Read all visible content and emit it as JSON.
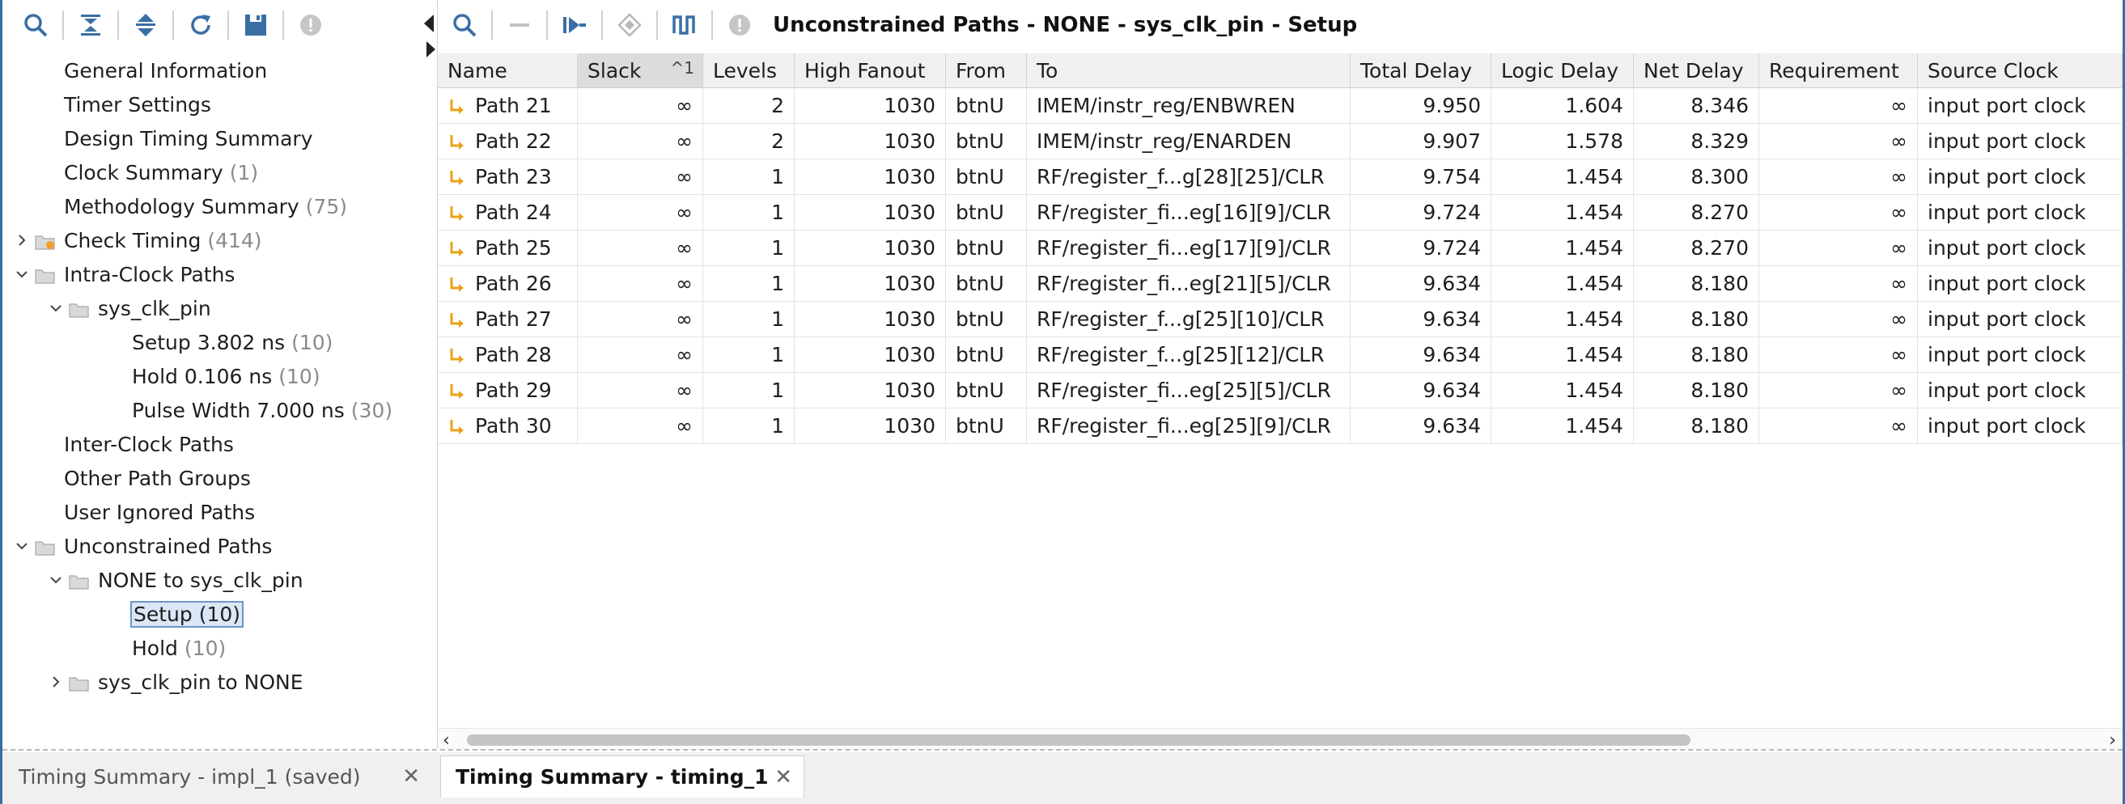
{
  "left_toolbar": {
    "icons": [
      "search-icon",
      "collapse-all-icon",
      "expand-all-icon",
      "refresh-icon",
      "save-icon",
      "disabled-icon"
    ]
  },
  "tree": {
    "items": [
      {
        "label": "General Information",
        "count": ""
      },
      {
        "label": "Timer Settings",
        "count": ""
      },
      {
        "label": "Design Timing Summary",
        "count": ""
      },
      {
        "label": "Clock Summary",
        "count": "(1)"
      },
      {
        "label": "Methodology Summary",
        "count": "(75)"
      },
      {
        "label": "Check Timing",
        "count": "(414)"
      },
      {
        "label": "Intra-Clock Paths",
        "count": ""
      },
      {
        "label": "sys_clk_pin",
        "count": ""
      },
      {
        "label": "Setup 3.802 ns",
        "count": "(10)"
      },
      {
        "label": "Hold 0.106 ns",
        "count": "(10)"
      },
      {
        "label": "Pulse Width 7.000 ns",
        "count": "(30)"
      },
      {
        "label": "Inter-Clock Paths",
        "count": ""
      },
      {
        "label": "Other Path Groups",
        "count": ""
      },
      {
        "label": "User Ignored Paths",
        "count": ""
      },
      {
        "label": "Unconstrained Paths",
        "count": ""
      },
      {
        "label": "NONE to sys_clk_pin",
        "count": ""
      },
      {
        "label": "Setup (10)",
        "count": ""
      },
      {
        "label": "Hold",
        "count": "(10)"
      },
      {
        "label": "sys_clk_pin to NONE",
        "count": ""
      }
    ]
  },
  "right_toolbar": {
    "title": "Unconstrained Paths - NONE - sys_clk_pin - Setup"
  },
  "table": {
    "columns": [
      "Name",
      "Slack",
      "Levels",
      "High Fanout",
      "From",
      "To",
      "Total Delay",
      "Logic Delay",
      "Net Delay",
      "Requirement",
      "Source Clock"
    ],
    "sort_indicator": "^1",
    "rows": [
      [
        "Path 21",
        "∞",
        "2",
        "1030",
        "btnU",
        "IMEM/instr_reg/ENBWREN",
        "9.950",
        "1.604",
        "8.346",
        "∞",
        "input port clock"
      ],
      [
        "Path 22",
        "∞",
        "2",
        "1030",
        "btnU",
        "IMEM/instr_reg/ENARDEN",
        "9.907",
        "1.578",
        "8.329",
        "∞",
        "input port clock"
      ],
      [
        "Path 23",
        "∞",
        "1",
        "1030",
        "btnU",
        "RF/register_f...g[28][25]/CLR",
        "9.754",
        "1.454",
        "8.300",
        "∞",
        "input port clock"
      ],
      [
        "Path 24",
        "∞",
        "1",
        "1030",
        "btnU",
        "RF/register_fi...eg[16][9]/CLR",
        "9.724",
        "1.454",
        "8.270",
        "∞",
        "input port clock"
      ],
      [
        "Path 25",
        "∞",
        "1",
        "1030",
        "btnU",
        "RF/register_fi...eg[17][9]/CLR",
        "9.724",
        "1.454",
        "8.270",
        "∞",
        "input port clock"
      ],
      [
        "Path 26",
        "∞",
        "1",
        "1030",
        "btnU",
        "RF/register_fi...eg[21][5]/CLR",
        "9.634",
        "1.454",
        "8.180",
        "∞",
        "input port clock"
      ],
      [
        "Path 27",
        "∞",
        "1",
        "1030",
        "btnU",
        "RF/register_f...g[25][10]/CLR",
        "9.634",
        "1.454",
        "8.180",
        "∞",
        "input port clock"
      ],
      [
        "Path 28",
        "∞",
        "1",
        "1030",
        "btnU",
        "RF/register_f...g[25][12]/CLR",
        "9.634",
        "1.454",
        "8.180",
        "∞",
        "input port clock"
      ],
      [
        "Path 29",
        "∞",
        "1",
        "1030",
        "btnU",
        "RF/register_fi...eg[25][5]/CLR",
        "9.634",
        "1.454",
        "8.180",
        "∞",
        "input port clock"
      ],
      [
        "Path 30",
        "∞",
        "1",
        "1030",
        "btnU",
        "RF/register_fi...eg[25][9]/CLR",
        "9.634",
        "1.454",
        "8.180",
        "∞",
        "input port clock"
      ]
    ]
  },
  "tabs": [
    {
      "label": "Timing Summary - impl_1 (saved)",
      "close": "✕"
    },
    {
      "label": "Timing Summary - timing_1",
      "close": "✕"
    }
  ],
  "colors": {
    "accent": "#3a6ea5",
    "path_icon": "#e8a317",
    "selection": "#dbe7f7"
  }
}
